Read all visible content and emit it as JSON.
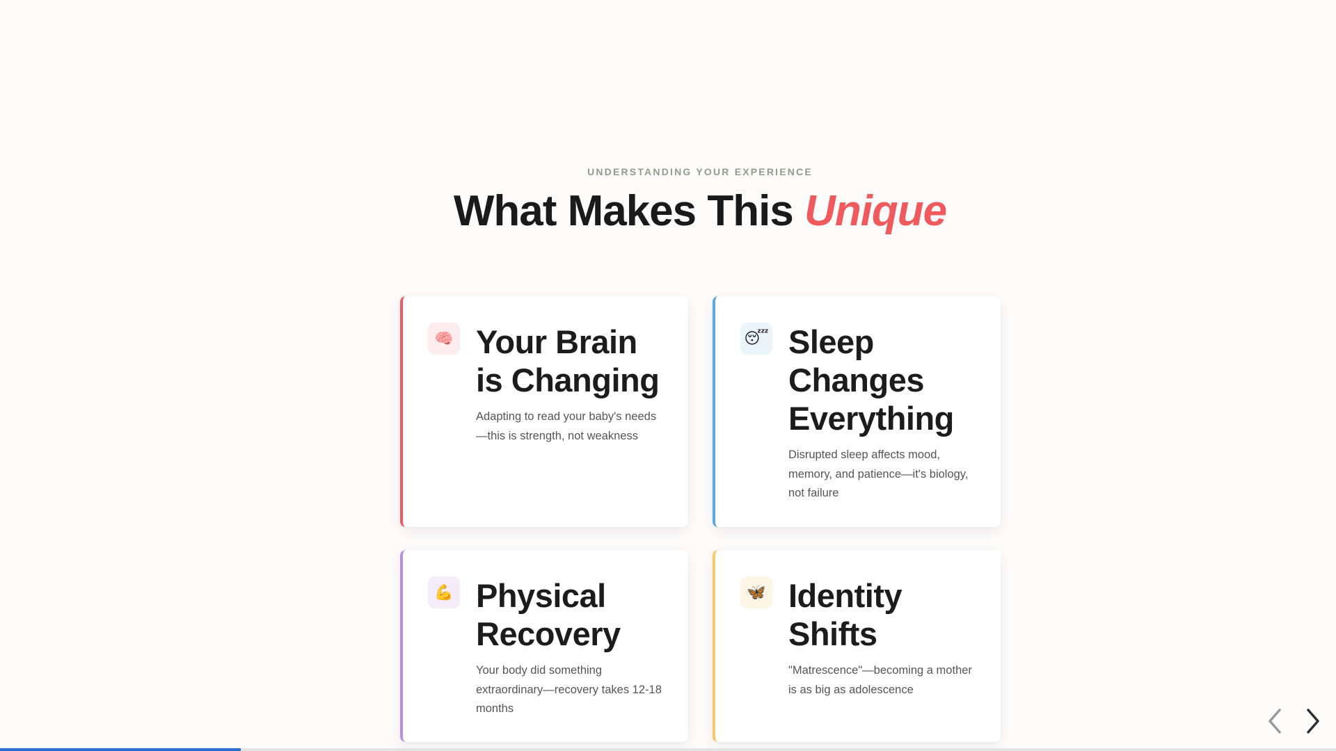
{
  "header": {
    "eyebrow": "UNDERSTANDING YOUR EXPERIENCE",
    "title_main": "What Makes This ",
    "title_accent": "Unique"
  },
  "cards": [
    {
      "icon": "brain-icon",
      "emoji": "🧠",
      "title": "Your Brain is Changing",
      "text": "Adapting to read your baby's needs—this is strength, not weakness",
      "accent_color": "#ec5a5e"
    },
    {
      "icon": "sleeping-face-icon",
      "emoji": "😴",
      "title": "Sleep Changes Everything",
      "text": "Disrupted sleep affects mood, memory, and patience—it's biology, not failure",
      "accent_color": "#5aa9e6"
    },
    {
      "icon": "flexed-biceps-icon",
      "emoji": "💪",
      "title": "Physical Recovery",
      "text": "Your body did something extraordinary—recovery takes 12-18 months",
      "accent_color": "#b98ee0"
    },
    {
      "icon": "butterfly-icon",
      "emoji": "🦋",
      "title": "Identity Shifts",
      "text": "\"Matrescence\"—becoming a mother is as big as adolescence",
      "accent_color": "#f5c86a"
    }
  ],
  "navigation": {
    "prev_icon": "chevron-left-icon",
    "next_icon": "chevron-right-icon"
  },
  "progress": {
    "fraction": 0.18
  },
  "colors": {
    "accent": "#ef5a5f",
    "eyebrow": "#8e9e8a",
    "progress": "#2a6dd2",
    "background": "#fdfcfb"
  }
}
